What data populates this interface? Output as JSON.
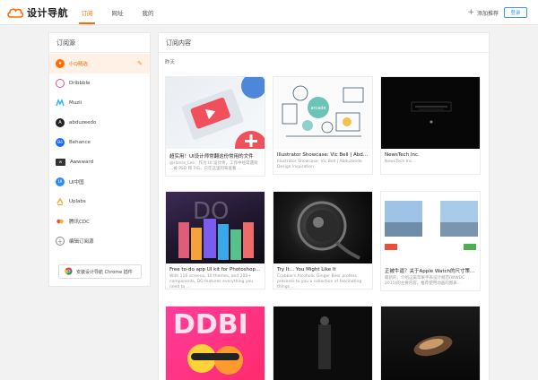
{
  "app": {
    "name": "设计导航"
  },
  "nav": [
    {
      "label": "订阅",
      "active": true
    },
    {
      "label": "网址",
      "active": false
    },
    {
      "label": "我的",
      "active": false
    }
  ],
  "topright": {
    "add_label": "添加推荐",
    "login_label": "登录"
  },
  "sidebar": {
    "title": "订阅源",
    "items": [
      {
        "label": "小Q精选",
        "icon": "star-icon",
        "color": "#ff6a00",
        "active": true
      },
      {
        "label": "Dribbble",
        "icon": "dribbble-icon",
        "color": "#ea4c89",
        "active": false
      },
      {
        "label": "Muzli",
        "icon": "muzli-icon",
        "color": "#29b6f6",
        "active": false
      },
      {
        "label": "abduzeedo",
        "icon": "abduzeedo-icon",
        "color": "#222222",
        "active": false
      },
      {
        "label": "Behance",
        "icon": "behance-icon",
        "color": "#1769ff",
        "active": false
      },
      {
        "label": "Awwward",
        "icon": "awwwards-icon",
        "color": "#333333",
        "active": false
      },
      {
        "label": "UI中国",
        "icon": "uicn-icon",
        "color": "#2d8cf0",
        "active": false
      },
      {
        "label": "Uplabs",
        "icon": "uplabs-icon",
        "color": "#f5a623",
        "active": false
      },
      {
        "label": "腾讯CDC",
        "icon": "cdc-icon",
        "color": "#e94b35",
        "active": false
      },
      {
        "label": "编辑订阅源",
        "icon": "edit-sources-icon",
        "color": "#555555",
        "active": false
      }
    ],
    "chrome_label": "安装设计导航 Chrome 插件"
  },
  "main": {
    "title": "订阅内容",
    "section_label": "昨天",
    "cards": [
      {
        "title": "超实用！UI设计师常翻这份常用的文件",
        "desc": "@Harris_Lee：作为 UI 设计师，工作中经常遇到 ...被 PSD 和 FIG，只在这里阿布查看 ..."
      },
      {
        "title": "Illustrator Showcase: Vic Bell | Abduzee...",
        "desc": "Illustrator Showcase: Vic Bell | Abduzeedo Design Inspiration"
      },
      {
        "title": "NewsTech Inc.",
        "desc": "NewsTech Inc."
      },
      {
        "title": "Free to-do app UI kit for Photoshop and ...",
        "desc": "With 116 screens, 10 themes, and 200+ components, DO features everything you need to ..."
      },
      {
        "title": "Try It… You Might Like It",
        "desc": "Crabbie's Alcoholic Ginger Beer profess presents to you a collection of fascinating things ..."
      },
      {
        "title": "正被牛逼？关于Apple Watch的尺寸策划的...",
        "desc": "最新的，介绍这篇苹果手表设计规范(WWDC 2015)的主要内容，推荐使用动画的图表..."
      },
      {
        "title": "",
        "desc": ""
      },
      {
        "title": "",
        "desc": ""
      },
      {
        "title": "",
        "desc": ""
      }
    ]
  }
}
